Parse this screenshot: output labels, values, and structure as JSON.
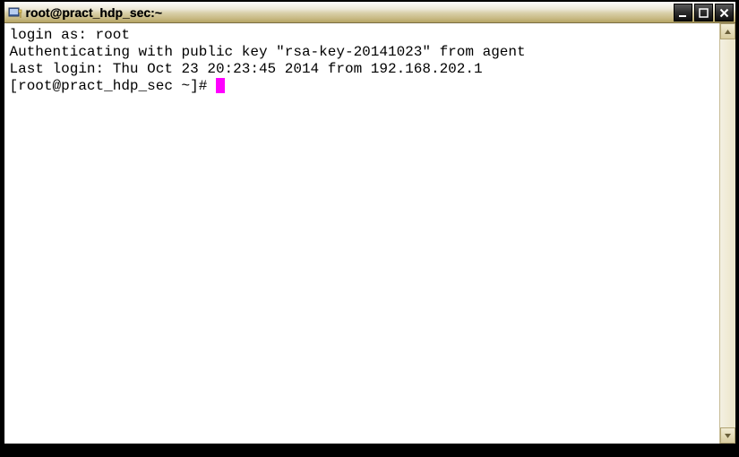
{
  "window": {
    "title": "root@pract_hdp_sec:~"
  },
  "terminal": {
    "lines": [
      "login as: root",
      "Authenticating with public key \"rsa-key-20141023\" from agent",
      "Last login: Thu Oct 23 20:23:45 2014 from 192.168.202.1"
    ],
    "prompt": "[root@pract_hdp_sec ~]# "
  }
}
